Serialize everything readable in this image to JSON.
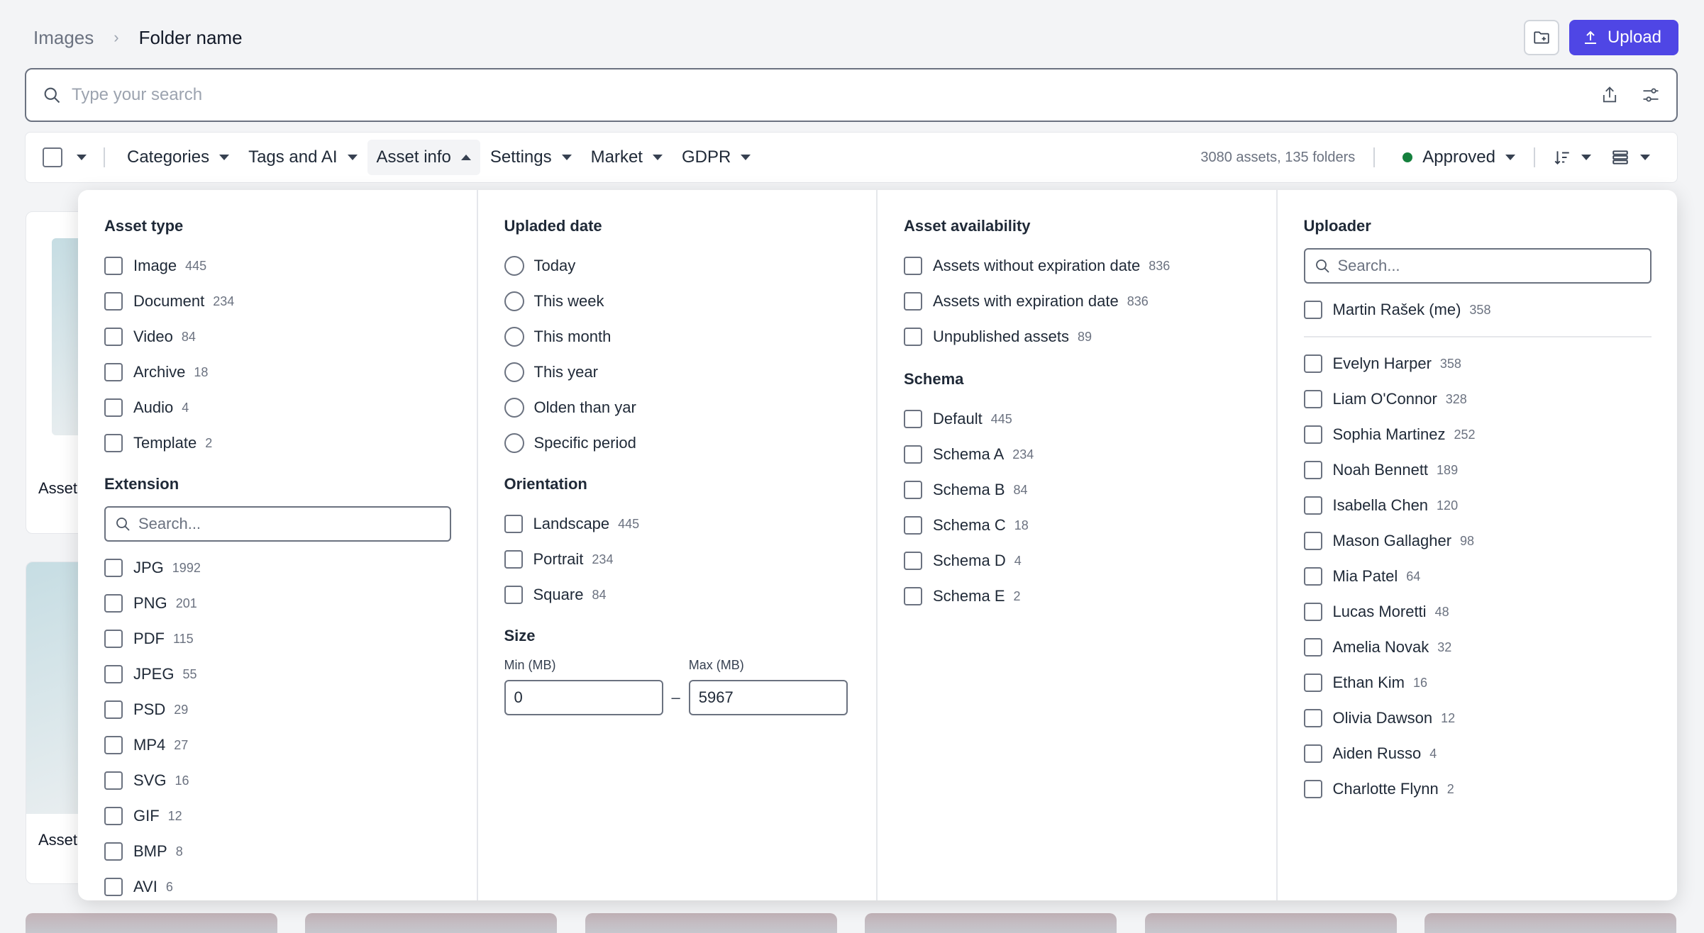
{
  "breadcrumb": {
    "root": "Images",
    "current": "Folder name"
  },
  "header": {
    "upload_label": "Upload"
  },
  "search": {
    "placeholder": "Type your search"
  },
  "filterbar": {
    "items": [
      {
        "label": "Categories",
        "active": false
      },
      {
        "label": "Tags and AI",
        "active": false
      },
      {
        "label": "Asset info",
        "active": true
      },
      {
        "label": "Settings",
        "active": false
      },
      {
        "label": "Market",
        "active": false
      },
      {
        "label": "GDPR",
        "active": false
      }
    ],
    "count_text": "3080 assets, 135 folders",
    "status_label": "Approved",
    "status_color": "#15803d"
  },
  "background": {
    "card_label_1": "Asset",
    "card_label_2": "Asset"
  },
  "panel": {
    "asset_type": {
      "title": "Asset type",
      "options": [
        {
          "label": "Image",
          "count": "445"
        },
        {
          "label": "Document",
          "count": "234"
        },
        {
          "label": "Video",
          "count": "84"
        },
        {
          "label": "Archive",
          "count": "18"
        },
        {
          "label": "Audio",
          "count": "4"
        },
        {
          "label": "Template",
          "count": "2"
        }
      ]
    },
    "extension": {
      "title": "Extension",
      "search_placeholder": "Search...",
      "options": [
        {
          "label": "JPG",
          "count": "1992"
        },
        {
          "label": "PNG",
          "count": "201"
        },
        {
          "label": "PDF",
          "count": "115"
        },
        {
          "label": "JPEG",
          "count": "55"
        },
        {
          "label": "PSD",
          "count": "29"
        },
        {
          "label": "MP4",
          "count": "27"
        },
        {
          "label": "SVG",
          "count": "16"
        },
        {
          "label": "GIF",
          "count": "12"
        },
        {
          "label": "BMP",
          "count": "8"
        },
        {
          "label": "AVI",
          "count": "6"
        }
      ]
    },
    "uploaded_date": {
      "title": "Upladed date",
      "options": [
        "Today",
        "This week",
        "This month",
        "This year",
        "Olden than yar",
        "Specific period"
      ]
    },
    "orientation": {
      "title": "Orientation",
      "options": [
        {
          "label": "Landscape",
          "count": "445"
        },
        {
          "label": "Portrait",
          "count": "234"
        },
        {
          "label": "Square",
          "count": "84"
        }
      ]
    },
    "size": {
      "title": "Size",
      "min_label": "Min (MB)",
      "max_label": "Max (MB)",
      "min_value": "0",
      "max_value": "5967",
      "dash": "–"
    },
    "availability": {
      "title": "Asset availability",
      "options": [
        {
          "label": "Assets without expiration date",
          "count": "836"
        },
        {
          "label": "Assets with expiration date",
          "count": "836"
        },
        {
          "label": "Unpublished assets",
          "count": "89"
        }
      ]
    },
    "schema": {
      "title": "Schema",
      "options": [
        {
          "label": "Default",
          "count": "445"
        },
        {
          "label": "Schema A",
          "count": "234"
        },
        {
          "label": "Schema B",
          "count": "84"
        },
        {
          "label": "Schema C",
          "count": "18"
        },
        {
          "label": "Schema D",
          "count": "4"
        },
        {
          "label": "Schema E",
          "count": "2"
        }
      ]
    },
    "uploader": {
      "title": "Uploader",
      "search_placeholder": "Search...",
      "me": {
        "label": "Martin Rašek (me)",
        "count": "358"
      },
      "options": [
        {
          "label": "Evelyn Harper",
          "count": "358"
        },
        {
          "label": "Liam O'Connor",
          "count": "328"
        },
        {
          "label": "Sophia Martinez",
          "count": "252"
        },
        {
          "label": "Noah Bennett",
          "count": "189"
        },
        {
          "label": "Isabella Chen",
          "count": "120"
        },
        {
          "label": "Mason Gallagher",
          "count": "98"
        },
        {
          "label": "Mia Patel",
          "count": "64"
        },
        {
          "label": "Lucas Moretti",
          "count": "48"
        },
        {
          "label": "Amelia Novak",
          "count": "32"
        },
        {
          "label": "Ethan Kim",
          "count": "16"
        },
        {
          "label": "Olivia Dawson",
          "count": "12"
        },
        {
          "label": "Aiden Russo",
          "count": "4"
        },
        {
          "label": "Charlotte Flynn",
          "count": "2"
        }
      ]
    }
  }
}
